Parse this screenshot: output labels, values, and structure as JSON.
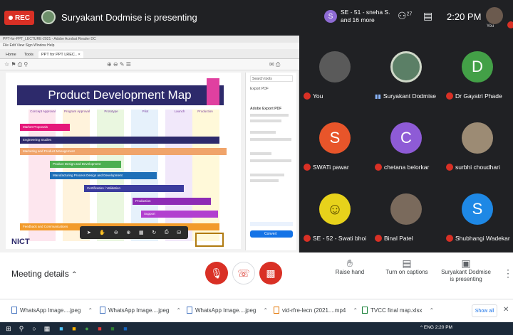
{
  "topbar": {
    "rec_label": "REC",
    "presenter_text": "Suryakant Dodmise is presenting",
    "people_avatar_letter": "S",
    "people_line1": "SE - 51 - sneha S.",
    "people_line2": "and 16 more",
    "participants_count": "27",
    "time": "2:20 PM",
    "you_label": "You"
  },
  "shared_screen": {
    "window_title": "PPT-for-PPT_LECTURE-2021 - Adobe Acrobat Reader DC",
    "menu": "File  Edit  View  Sign  Window  Help",
    "tabs": [
      "Home",
      "Tools",
      "PPT for PPT LREC..  ×"
    ],
    "doc_title": "Product Development Map",
    "columns": [
      "Concept Approval",
      "Program Approval",
      "Prototype",
      "Pilot",
      "Launch",
      "Production"
    ],
    "bars": [
      "Market Proposals",
      "Engineering Studies",
      "Marketing and Product Management",
      "Product Design and Development",
      "Manufacturing Process Design and Development",
      "Certification / Validation",
      "Production",
      "Support",
      "Feedback and Communications"
    ],
    "logo_text": "NICT",
    "sidebar": {
      "search": "Search tools",
      "export_label": "Export PDF",
      "adobe_title": "Adobe Export PDF",
      "convert_label": "Convert",
      "button_label": "Convert"
    }
  },
  "tiles": [
    {
      "name": "You",
      "letter": "",
      "color": "#5a5a5a",
      "mic": "off"
    },
    {
      "name": "Suryakant Dodmise",
      "letter": "",
      "color": "#5b7f66",
      "mic": "speaking"
    },
    {
      "name": "Dr Gayatri Phade",
      "letter": "D",
      "color": "#43a047",
      "mic": "off"
    },
    {
      "name": "SWATi pawar",
      "letter": "S",
      "color": "#e8552a",
      "mic": "off"
    },
    {
      "name": "chetana belorkar",
      "letter": "C",
      "color": "#8e5bd6",
      "mic": "off"
    },
    {
      "name": "surbhi choudhari",
      "letter": "",
      "color": "#9c8b74",
      "mic": "off"
    },
    {
      "name": "SE - 52 - Swati bhoi",
      "letter": "",
      "color": "#e7d21b",
      "mic": "off"
    },
    {
      "name": "Binal Patel",
      "letter": "",
      "color": "#7a6a5c",
      "mic": "off"
    },
    {
      "name": "Shubhangi Wadekar",
      "letter": "S",
      "color": "#1e88e5",
      "mic": "off"
    }
  ],
  "bottombar": {
    "meeting_details": "Meeting details",
    "raise_hand": "Raise hand",
    "captions": "Turn on captions",
    "presenting_line1": "Suryakant Dodmise",
    "presenting_line2": "is presenting"
  },
  "downloads": [
    {
      "name": "WhatsApp Image....jpeg"
    },
    {
      "name": "WhatsApp Image....jpeg"
    },
    {
      "name": "WhatsApp Image....jpeg"
    },
    {
      "name": "vid-rfre-lecn (2021....mp4"
    },
    {
      "name": "TVCC final map.xlsx"
    }
  ],
  "downloads_show_all": "Show all",
  "taskbar": {
    "tray": "^ ENG  2:20 PM"
  },
  "colors": {
    "meet_dark": "#202124",
    "mic_red": "#d93025",
    "accent_blue": "#1a73e8"
  }
}
